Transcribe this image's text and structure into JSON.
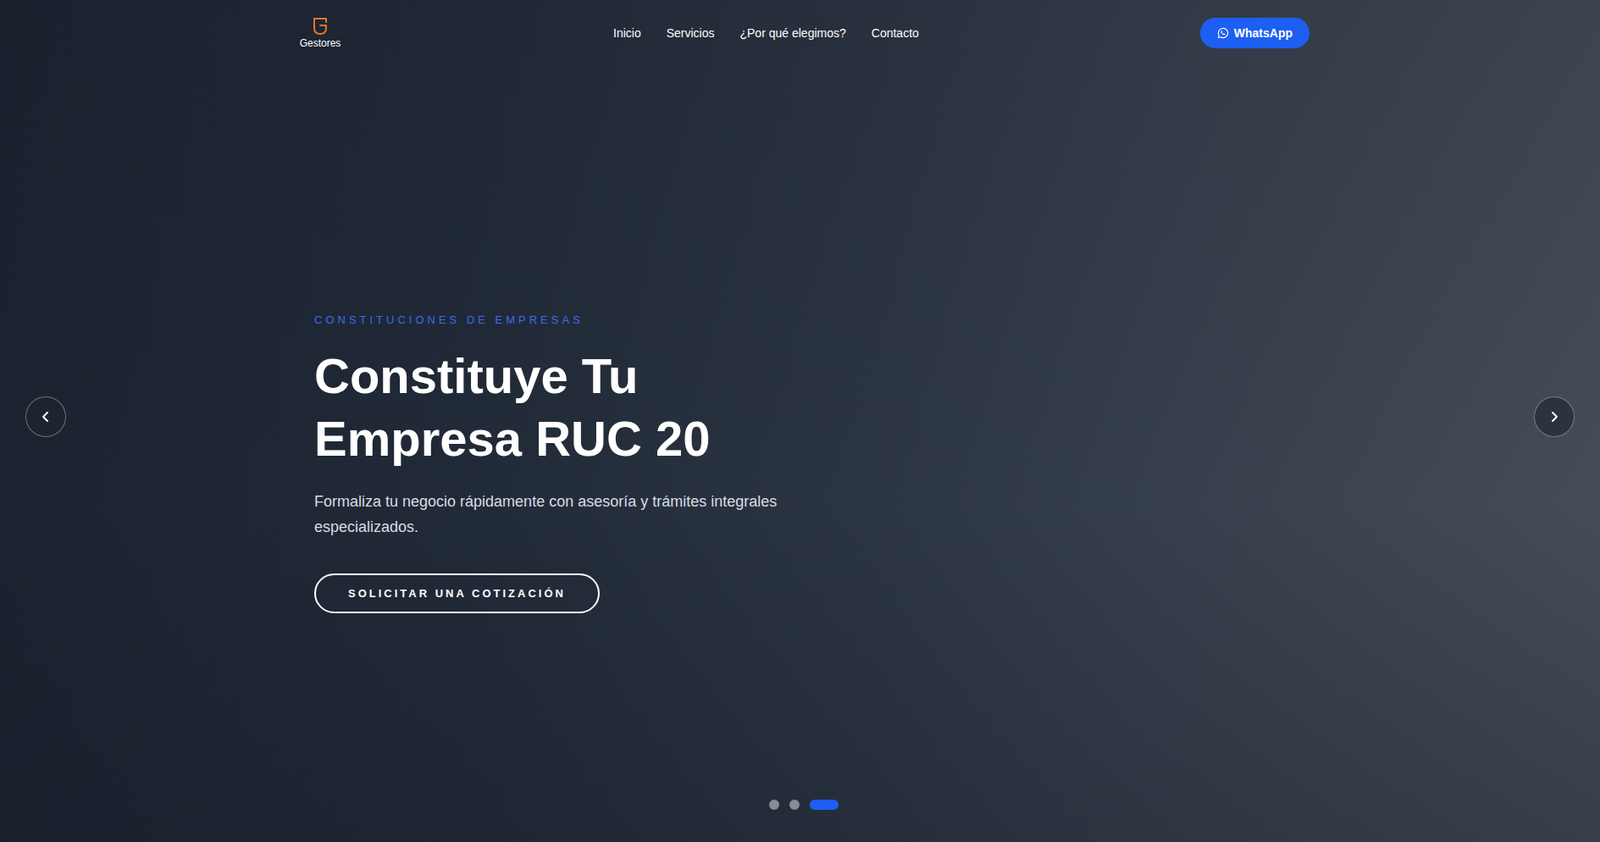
{
  "header": {
    "logo": "Gestores",
    "nav": [
      {
        "label": "Inicio",
        "selected": false
      },
      {
        "label": "Servicios",
        "selected": false
      },
      {
        "label": "¿Por qué elegimos?",
        "selected": false
      },
      {
        "label": "Contacto",
        "selected": false
      }
    ],
    "cta": "WhatsApp"
  },
  "hero": {
    "eyebrow": "CONSTITUCIONES DE EMPRESAS",
    "title_lines": [
      "Constituye Tu",
      "Empresa RUC 20"
    ],
    "description": "Formaliza tu negocio rápidamente con asesoría y trámites integrales especializados.",
    "button": "SOLICITAR UNA COTIZACIÓN"
  },
  "carousel": {
    "slides": [
      {
        "selected": false
      },
      {
        "selected": false
      },
      {
        "selected": true
      }
    ]
  }
}
